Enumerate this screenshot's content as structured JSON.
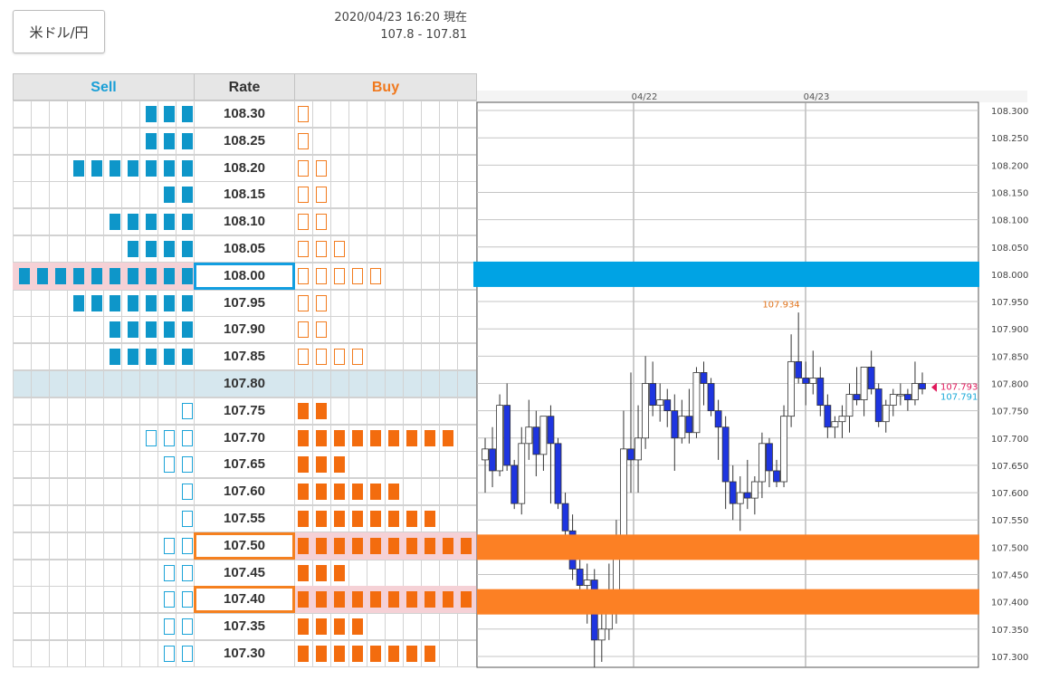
{
  "header": {
    "pair_label": "米ドル/円",
    "timestamp": "2020/04/23 16:20 現在",
    "quote": "107.8 - 107.81"
  },
  "order_book": {
    "columns": {
      "sell": "Sell",
      "rate": "Rate",
      "buy": "Buy"
    },
    "colors": {
      "sell": "#1a9fd6",
      "buy": "#f0791e",
      "current_row": "#d6e7ee",
      "highlight": "#f5d1d6"
    },
    "rows": [
      {
        "rate": "108.30",
        "sell": 3,
        "sell_style": "filled",
        "buy": 1,
        "buy_style": "outline"
      },
      {
        "rate": "108.25",
        "sell": 3,
        "sell_style": "filled",
        "buy": 1,
        "buy_style": "outline"
      },
      {
        "rate": "108.20",
        "sell": 7,
        "sell_style": "filled",
        "buy": 2,
        "buy_style": "outline"
      },
      {
        "rate": "108.15",
        "sell": 2,
        "sell_style": "filled",
        "buy": 2,
        "buy_style": "outline"
      },
      {
        "rate": "108.10",
        "sell": 5,
        "sell_style": "filled",
        "buy": 2,
        "buy_style": "outline"
      },
      {
        "rate": "108.05",
        "sell": 4,
        "sell_style": "filled",
        "buy": 3,
        "buy_style": "outline"
      },
      {
        "rate": "108.00",
        "sell": 10,
        "sell_style": "filled",
        "buy": 5,
        "buy_style": "outline",
        "highlight": "blue"
      },
      {
        "rate": "107.95",
        "sell": 7,
        "sell_style": "filled",
        "buy": 2,
        "buy_style": "outline"
      },
      {
        "rate": "107.90",
        "sell": 5,
        "sell_style": "filled",
        "buy": 2,
        "buy_style": "outline"
      },
      {
        "rate": "107.85",
        "sell": 5,
        "sell_style": "filled",
        "buy": 4,
        "buy_style": "outline"
      },
      {
        "rate": "107.80",
        "sell": 0,
        "sell_style": "filled",
        "buy": 0,
        "buy_style": "filled",
        "current": true
      },
      {
        "rate": "107.75",
        "sell": 1,
        "sell_style": "outline",
        "buy": 2,
        "buy_style": "filled"
      },
      {
        "rate": "107.70",
        "sell": 3,
        "sell_style": "outline",
        "buy": 9,
        "buy_style": "filled"
      },
      {
        "rate": "107.65",
        "sell": 2,
        "sell_style": "outline",
        "buy": 3,
        "buy_style": "filled"
      },
      {
        "rate": "107.60",
        "sell": 1,
        "sell_style": "outline",
        "buy": 6,
        "buy_style": "filled"
      },
      {
        "rate": "107.55",
        "sell": 1,
        "sell_style": "outline",
        "buy": 8,
        "buy_style": "filled"
      },
      {
        "rate": "107.50",
        "sell": 2,
        "sell_style": "outline",
        "buy": 10,
        "buy_style": "filled",
        "highlight": "orange"
      },
      {
        "rate": "107.45",
        "sell": 2,
        "sell_style": "outline",
        "buy": 3,
        "buy_style": "filled"
      },
      {
        "rate": "107.40",
        "sell": 2,
        "sell_style": "outline",
        "buy": 10,
        "buy_style": "filled",
        "highlight": "orange"
      },
      {
        "rate": "107.35",
        "sell": 2,
        "sell_style": "outline",
        "buy": 4,
        "buy_style": "filled"
      },
      {
        "rate": "107.30",
        "sell": 2,
        "sell_style": "outline",
        "buy": 8,
        "buy_style": "filled"
      }
    ]
  },
  "chart_data": {
    "type": "candlestick",
    "x_labels": [
      "04/22",
      "04/23"
    ],
    "y_ticks": [
      "108.300",
      "108.250",
      "108.200",
      "108.150",
      "108.100",
      "108.050",
      "108.000",
      "107.950",
      "107.900",
      "107.850",
      "107.800",
      "107.750",
      "107.700",
      "107.650",
      "107.600",
      "107.550",
      "107.500",
      "107.450",
      "107.400",
      "107.350",
      "107.300"
    ],
    "ylim": [
      107.28,
      108.315
    ],
    "grid": true,
    "bands": [
      {
        "level": 108.0,
        "color": "#00a3e4"
      },
      {
        "level": 107.5,
        "color": "#fc8024"
      },
      {
        "level": 107.4,
        "color": "#fc8024"
      }
    ],
    "annotations": [
      {
        "text": "107.934",
        "value": 107.934,
        "color": "#e0731b"
      }
    ],
    "price_labels": [
      {
        "text": "107.793",
        "value": 107.793,
        "color": "#e0195b"
      },
      {
        "text": "107.791",
        "value": 107.791,
        "color": "#19a9d8"
      }
    ],
    "colors": {
      "up": "#ffffff",
      "down": "#1e35e0"
    },
    "candles": [
      {
        "o": 107.66,
        "h": 107.7,
        "l": 107.6,
        "c": 107.68
      },
      {
        "o": 107.68,
        "h": 107.72,
        "l": 107.61,
        "c": 107.64
      },
      {
        "o": 107.64,
        "h": 107.78,
        "l": 107.63,
        "c": 107.76
      },
      {
        "o": 107.76,
        "h": 107.8,
        "l": 107.64,
        "c": 107.65
      },
      {
        "o": 107.65,
        "h": 107.66,
        "l": 107.57,
        "c": 107.58
      },
      {
        "o": 107.58,
        "h": 107.72,
        "l": 107.56,
        "c": 107.69
      },
      {
        "o": 107.69,
        "h": 107.77,
        "l": 107.66,
        "c": 107.72
      },
      {
        "o": 107.72,
        "h": 107.75,
        "l": 107.63,
        "c": 107.67
      },
      {
        "o": 107.67,
        "h": 107.74,
        "l": 107.64,
        "c": 107.74
      },
      {
        "o": 107.74,
        "h": 107.76,
        "l": 107.58,
        "c": 107.69
      },
      {
        "o": 107.69,
        "h": 107.7,
        "l": 107.57,
        "c": 107.58
      },
      {
        "o": 107.58,
        "h": 107.6,
        "l": 107.51,
        "c": 107.53
      },
      {
        "o": 107.53,
        "h": 107.56,
        "l": 107.44,
        "c": 107.46
      },
      {
        "o": 107.46,
        "h": 107.48,
        "l": 107.39,
        "c": 107.43
      },
      {
        "o": 107.43,
        "h": 107.47,
        "l": 107.36,
        "c": 107.44
      },
      {
        "o": 107.44,
        "h": 107.46,
        "l": 107.28,
        "c": 107.33
      },
      {
        "o": 107.33,
        "h": 107.4,
        "l": 107.29,
        "c": 107.35
      },
      {
        "o": 107.35,
        "h": 107.47,
        "l": 107.33,
        "c": 107.42
      },
      {
        "o": 107.42,
        "h": 107.55,
        "l": 107.36,
        "c": 107.52
      },
      {
        "o": 107.52,
        "h": 107.75,
        "l": 107.49,
        "c": 107.68
      },
      {
        "o": 107.68,
        "h": 107.82,
        "l": 107.6,
        "c": 107.66
      },
      {
        "o": 107.66,
        "h": 107.76,
        "l": 107.6,
        "c": 107.7
      },
      {
        "o": 107.7,
        "h": 107.85,
        "l": 107.68,
        "c": 107.8
      },
      {
        "o": 107.8,
        "h": 107.84,
        "l": 107.74,
        "c": 107.76
      },
      {
        "o": 107.76,
        "h": 107.8,
        "l": 107.73,
        "c": 107.77
      },
      {
        "o": 107.77,
        "h": 107.79,
        "l": 107.72,
        "c": 107.75
      },
      {
        "o": 107.75,
        "h": 107.78,
        "l": 107.64,
        "c": 107.7
      },
      {
        "o": 107.7,
        "h": 107.77,
        "l": 107.69,
        "c": 107.74
      },
      {
        "o": 107.74,
        "h": 107.79,
        "l": 107.69,
        "c": 107.71
      },
      {
        "o": 107.71,
        "h": 107.83,
        "l": 107.7,
        "c": 107.82
      },
      {
        "o": 107.82,
        "h": 107.84,
        "l": 107.76,
        "c": 107.8
      },
      {
        "o": 107.8,
        "h": 107.81,
        "l": 107.74,
        "c": 107.75
      },
      {
        "o": 107.75,
        "h": 107.77,
        "l": 107.66,
        "c": 107.72
      },
      {
        "o": 107.72,
        "h": 107.74,
        "l": 107.57,
        "c": 107.62
      },
      {
        "o": 107.62,
        "h": 107.65,
        "l": 107.55,
        "c": 107.58
      },
      {
        "o": 107.58,
        "h": 107.63,
        "l": 107.53,
        "c": 107.6
      },
      {
        "o": 107.6,
        "h": 107.66,
        "l": 107.57,
        "c": 107.59
      },
      {
        "o": 107.59,
        "h": 107.63,
        "l": 107.56,
        "c": 107.62
      },
      {
        "o": 107.62,
        "h": 107.71,
        "l": 107.59,
        "c": 107.69
      },
      {
        "o": 107.69,
        "h": 107.7,
        "l": 107.61,
        "c": 107.64
      },
      {
        "o": 107.64,
        "h": 107.66,
        "l": 107.61,
        "c": 107.62
      },
      {
        "o": 107.62,
        "h": 107.76,
        "l": 107.61,
        "c": 107.74
      },
      {
        "o": 107.74,
        "h": 107.89,
        "l": 107.72,
        "c": 107.84
      },
      {
        "o": 107.84,
        "h": 107.93,
        "l": 107.8,
        "c": 107.81
      },
      {
        "o": 107.81,
        "h": 107.84,
        "l": 107.76,
        "c": 107.8
      },
      {
        "o": 107.8,
        "h": 107.86,
        "l": 107.78,
        "c": 107.81
      },
      {
        "o": 107.81,
        "h": 107.83,
        "l": 107.74,
        "c": 107.76
      },
      {
        "o": 107.76,
        "h": 107.78,
        "l": 107.7,
        "c": 107.72
      },
      {
        "o": 107.72,
        "h": 107.74,
        "l": 107.7,
        "c": 107.73
      },
      {
        "o": 107.73,
        "h": 107.76,
        "l": 107.7,
        "c": 107.74
      },
      {
        "o": 107.74,
        "h": 107.8,
        "l": 107.71,
        "c": 107.78
      },
      {
        "o": 107.78,
        "h": 107.83,
        "l": 107.76,
        "c": 107.77
      },
      {
        "o": 107.77,
        "h": 107.82,
        "l": 107.74,
        "c": 107.83
      },
      {
        "o": 107.83,
        "h": 107.86,
        "l": 107.78,
        "c": 107.79
      },
      {
        "o": 107.79,
        "h": 107.8,
        "l": 107.72,
        "c": 107.73
      },
      {
        "o": 107.73,
        "h": 107.77,
        "l": 107.71,
        "c": 107.76
      },
      {
        "o": 107.76,
        "h": 107.79,
        "l": 107.74,
        "c": 107.78
      },
      {
        "o": 107.78,
        "h": 107.8,
        "l": 107.76,
        "c": 107.78
      },
      {
        "o": 107.78,
        "h": 107.79,
        "l": 107.75,
        "c": 107.77
      },
      {
        "o": 107.77,
        "h": 107.84,
        "l": 107.76,
        "c": 107.8
      },
      {
        "o": 107.8,
        "h": 107.82,
        "l": 107.78,
        "c": 107.79
      }
    ]
  }
}
